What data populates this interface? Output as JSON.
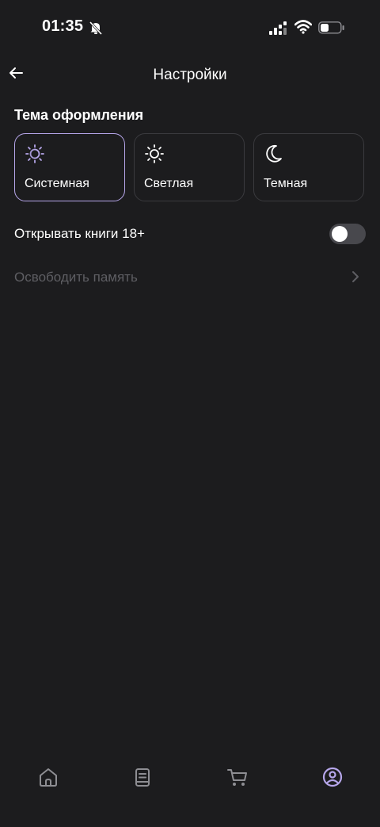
{
  "status_bar": {
    "time": "01:35"
  },
  "header": {
    "title": "Настройки"
  },
  "theme_section": {
    "title": "Тема оформления",
    "options": [
      {
        "label": "Системная",
        "icon": "system-theme-icon",
        "selected": true
      },
      {
        "label": "Светлая",
        "icon": "sun-icon",
        "selected": false
      },
      {
        "label": "Темная",
        "icon": "moon-icon",
        "selected": false
      }
    ]
  },
  "settings": {
    "adult_books_label": "Открывать книги 18+",
    "adult_books_enabled": false,
    "free_memory_label": "Освободить память"
  },
  "bottom_nav": [
    "home-icon",
    "book-icon",
    "cart-icon",
    "profile-icon"
  ],
  "colors": {
    "background": "#1c1c1e",
    "accent": "#b6a6ea",
    "muted": "#5e5e63"
  }
}
